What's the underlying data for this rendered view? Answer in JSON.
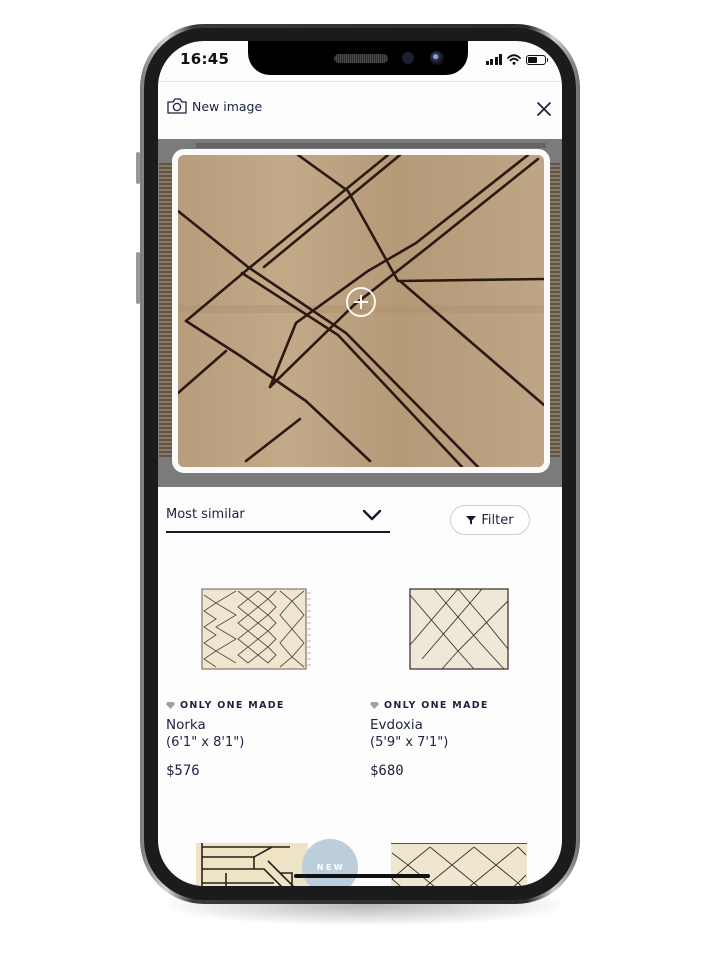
{
  "status_bar": {
    "time": "16:45",
    "signal_bars": 4,
    "battery_level": 0.55
  },
  "header": {
    "new_image_label": "New image",
    "new_image_icon": "camera-icon",
    "close_icon": "close-icon"
  },
  "image_preview": {
    "zoom_icon": "plus-circle-icon"
  },
  "controls": {
    "sort_label": "Most similar",
    "sort_icon": "chevron-down-icon",
    "filter_label": "Filter",
    "filter_icon": "funnel-icon"
  },
  "products": [
    {
      "badge": "ONLY ONE MADE",
      "badge_icon": "diamond-icon",
      "name": "Norka",
      "size": "(6'1\" x 8'1\")",
      "price": "$576"
    },
    {
      "badge": "ONLY ONE MADE",
      "badge_icon": "diamond-icon",
      "name": "Evdoxia",
      "size": "(5'9\" x 7'1\")",
      "price": "$680"
    }
  ],
  "new_badge": {
    "label": "NEW"
  },
  "colors": {
    "text": "#1c2340",
    "image_backdrop": "#7b7b7b",
    "new_badge": "#bccddb",
    "rug_main": "#b9a07f",
    "rug_lines": "#2a1a12",
    "rug_light": "#efe6d2"
  }
}
